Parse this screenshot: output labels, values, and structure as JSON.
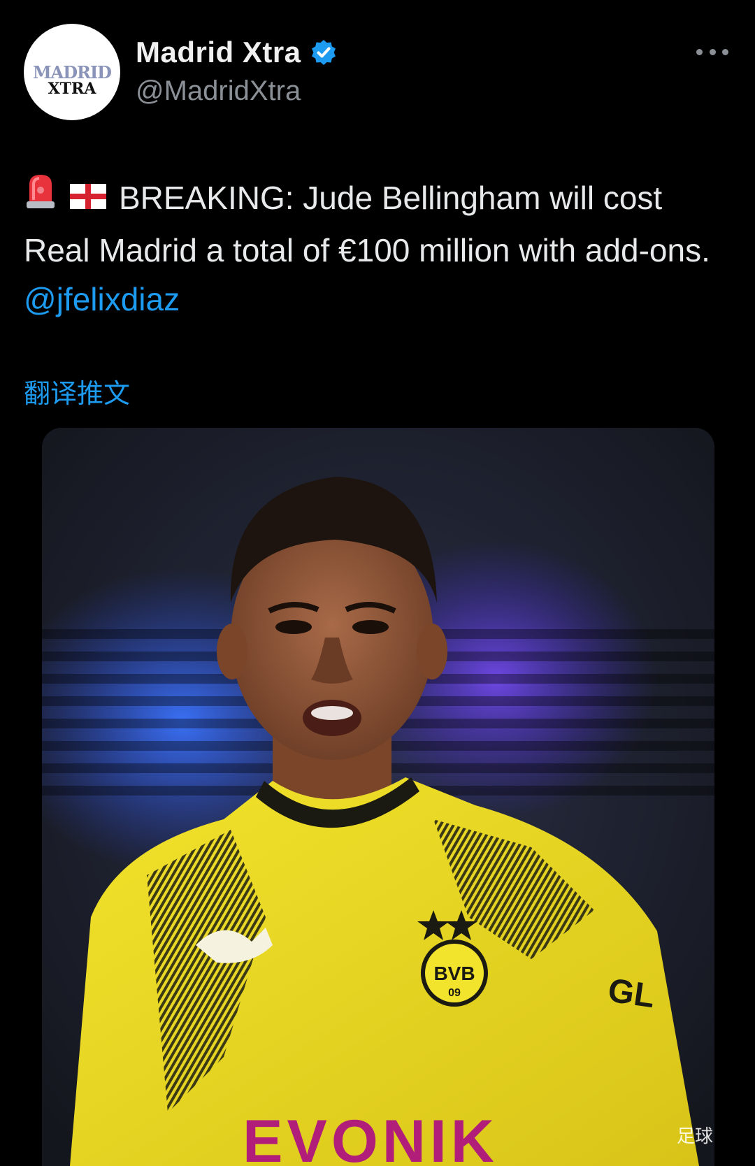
{
  "account": {
    "display_name": "Madrid Xtra",
    "handle": "@MadridXtra",
    "avatar_line1": "MADRID",
    "avatar_line2": "XTRA",
    "verified": true
  },
  "tweet": {
    "emojis": [
      "rotating-light-icon",
      "england-flag-icon"
    ],
    "text": "BREAKING: Jude Bellingham will cost Real Madrid a total of €100 million with add-ons.",
    "mention": "@jfelixdiaz",
    "translate_label": "翻译推文"
  },
  "media": {
    "type": "photo",
    "sponsor_text": "GL",
    "club_badge_text": "BVB",
    "club_badge_year": "09",
    "shirt_text": "EVONIK"
  },
  "watermark": "足球",
  "colors": {
    "background": "#000000",
    "link": "#1d9bf0",
    "verified": "#1d9bf0",
    "text": "#e7e9ea",
    "muted": "#8b9097"
  }
}
